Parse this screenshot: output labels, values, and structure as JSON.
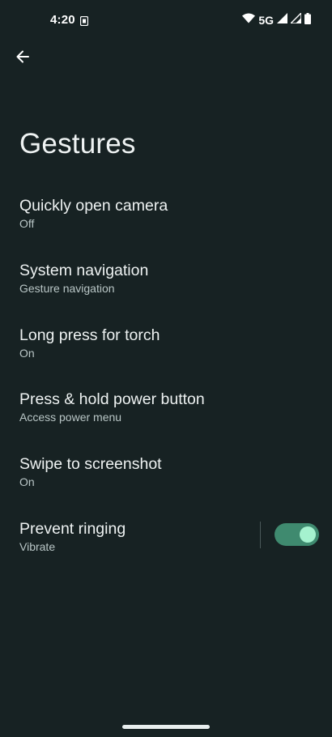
{
  "status_bar": {
    "time": "4:20",
    "network": "5G",
    "icons": [
      "sim-notification-icon",
      "wifi-icon",
      "signal-icon",
      "signal-icon",
      "battery-icon"
    ]
  },
  "header": {
    "back_icon": "arrow-left-icon",
    "title": "Gestures"
  },
  "settings": [
    {
      "title": "Quickly open camera",
      "summary": "Off"
    },
    {
      "title": "System navigation",
      "summary": "Gesture navigation"
    },
    {
      "title": "Long press for torch",
      "summary": "On"
    },
    {
      "title": "Press & hold power button",
      "summary": "Access power menu"
    },
    {
      "title": "Swipe to screenshot",
      "summary": "On"
    },
    {
      "title": "Prevent ringing",
      "summary": "Vibrate",
      "toggle": true
    }
  ],
  "colors": {
    "background": "#172223",
    "toggle_track": "#3f8a6f",
    "toggle_thumb": "#a5f2cf"
  }
}
